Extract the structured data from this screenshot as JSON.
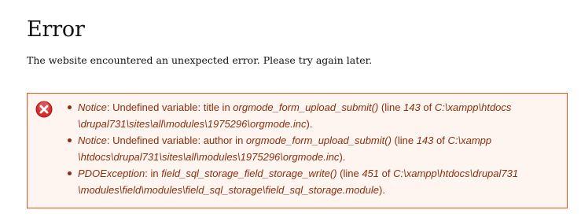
{
  "page": {
    "title": "Error",
    "intro": "The website encountered an unexpected error. Please try again later."
  },
  "messages": {
    "icon": "error-x-icon",
    "colors": {
      "border": "#ed541d",
      "background": "#fef5f1",
      "text": "#8c2e0b",
      "icon_fill": "#d52d2d"
    },
    "items": [
      {
        "type": "Notice",
        "sep1": ": Undefined variable: title in ",
        "function": "orgmode_form_upload_submit()",
        "sep2": " (line ",
        "line": "143",
        "sep3": " of ",
        "file_line1": "C:\\xampp\\htdocs",
        "file_line2": "\\drupal731\\sites\\all\\modules\\1975296\\orgmode.inc",
        "end": ")."
      },
      {
        "type": "Notice",
        "sep1": ": Undefined variable: author in ",
        "function": "orgmode_form_upload_submit()",
        "sep2": " (line ",
        "line": "143",
        "sep3": " of ",
        "file_line1": "C:\\xampp",
        "file_line2": "\\htdocs\\drupal731\\sites\\all\\modules\\1975296\\orgmode.inc",
        "end": ")."
      },
      {
        "type": "PDOException",
        "sep1": ": in ",
        "function": "field_sql_storage_field_storage_write()",
        "sep2": " (line ",
        "line": "451",
        "sep3": " of ",
        "file_line1": "C:\\xampp\\htdocs\\drupal731",
        "file_line2": "\\modules\\field\\modules\\field_sql_storage\\field_sql_storage.module",
        "end": ")."
      }
    ]
  }
}
